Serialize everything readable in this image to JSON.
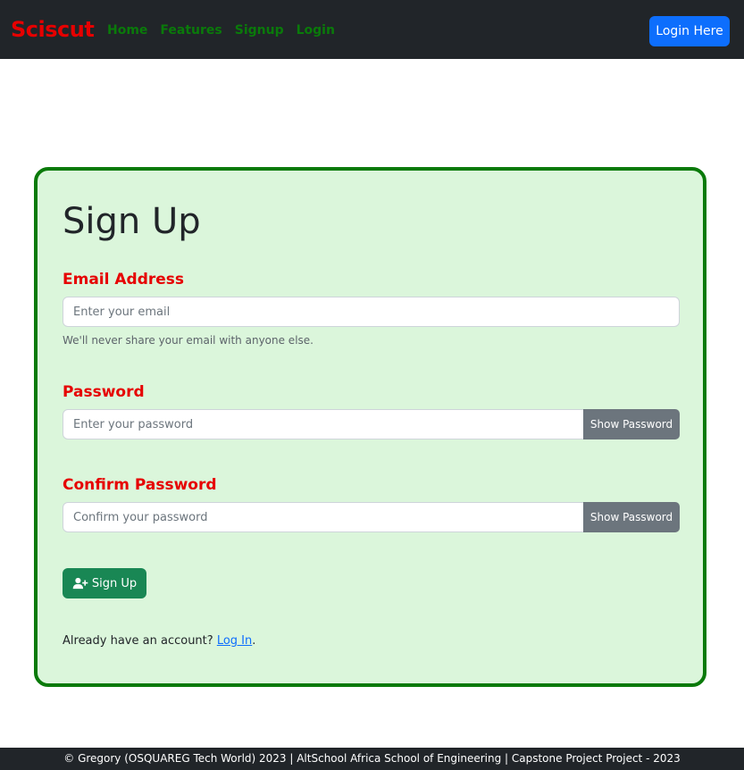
{
  "nav": {
    "brand": "Sciscut",
    "links": [
      {
        "label": "Home"
      },
      {
        "label": "Features"
      },
      {
        "label": "Signup"
      },
      {
        "label": "Login"
      }
    ],
    "login_button": "Login Here"
  },
  "form": {
    "title": "Sign Up",
    "email": {
      "label": "Email Address",
      "placeholder": "Enter your email",
      "value": "",
      "help": "We'll never share your email with anyone else."
    },
    "password": {
      "label": "Password",
      "placeholder": "Enter your password",
      "value": "",
      "toggle_label": "Show Password"
    },
    "confirm_password": {
      "label": "Confirm Password",
      "placeholder": "Confirm your password",
      "value": "",
      "toggle_label": "Show Password"
    },
    "submit_label": "Sign Up",
    "submit_icon": "user-plus-icon",
    "account_prompt": "Already have an account?",
    "login_link": "Log In",
    "login_link_suffix": "."
  },
  "footer": {
    "text": "© Gregory (OSQUAREG Tech World) 2023 | AltSchool Africa School of Engineering | Capstone Project Project - 2023"
  },
  "colors": {
    "navbar_bg": "#212529",
    "brand": "#e60000",
    "nav_link": "#0a7a0a",
    "primary": "#0d6efd",
    "card_bg": "#dbf6db",
    "card_border": "#0a7a0a",
    "label": "#e60000",
    "success": "#198754",
    "secondary": "#6c757d"
  }
}
